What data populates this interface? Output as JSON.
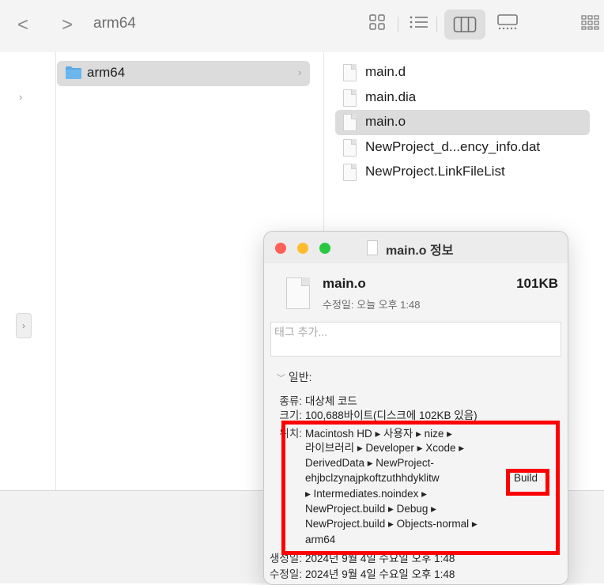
{
  "toolbar": {
    "title": "arm64",
    "back_glyph": "<",
    "forward_glyph": ">",
    "icons": [
      "icon-view-grid",
      "list-view-icon",
      "column-view-icon",
      "gallery-view-icon",
      "group-icon"
    ]
  },
  "column1": {
    "folder": {
      "label": "arm64",
      "icon": "folder-icon"
    }
  },
  "files": [
    {
      "label": "main.d"
    },
    {
      "label": "main.dia"
    },
    {
      "label": "main.o",
      "selected": true
    },
    {
      "label": "NewProject_d...ency_info.dat"
    },
    {
      "label": "NewProject.LinkFileList"
    }
  ],
  "info_window": {
    "title": "main.o 정보",
    "file_name": "main.o",
    "file_size": "101KB",
    "modified": "수정일: 오늘 오후 1:48",
    "tag_placeholder": "태그 추가...",
    "section": "일반:",
    "kind_label": "종류:",
    "kind_value": "대상체 코드",
    "size_label": "크기:",
    "size_value": "100,688바이트(디스크에 102KB 있음)",
    "where_label": "위치:",
    "where_lines": [
      "Macintosh HD ▸ 사용자 ▸ nize ▸",
      "라이브러리 ▸ Developer ▸ Xcode ▸",
      "DerivedData ▸ NewProject-",
      "ehjbclzynajpkoftzuthhdyklitw",
      "▸ Intermediates.noindex ▸",
      "NewProject.build ▸ Debug ▸",
      "NewProject.build ▸ Objects-normal ▸",
      "arm64"
    ],
    "build_word": "Build",
    "created_label": "생성일:",
    "created_value": "2024년 9월 4일 수요일 오후 1:48",
    "modified_label": "수정일:",
    "modified_value": "2024년 9월 4일 수요일 오후 1:48"
  },
  "colors": {
    "highlight_red": "#ff0000",
    "traffic_close": "#fe5f57",
    "traffic_minimize": "#febc2e",
    "traffic_zoom": "#28c840",
    "folder_blue": "#5aa9e6"
  }
}
